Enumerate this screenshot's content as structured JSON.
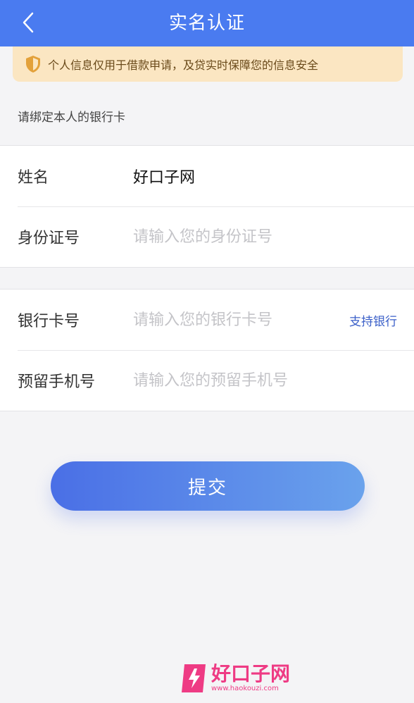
{
  "header": {
    "title": "实名认证",
    "back_icon": "chevron-left-icon",
    "background": "#4a7bf0"
  },
  "notice": {
    "icon": "shield-icon",
    "text": "个人信息仅用于借款申请，及贷实时保障您的信息安全",
    "background": "#fbe6c2"
  },
  "hint": "请绑定本人的银行卡",
  "form": {
    "name": {
      "label": "姓名",
      "value": "好口子网"
    },
    "id_number": {
      "label": "身份证号",
      "placeholder": "请输入您的身份证号"
    },
    "bank_card": {
      "label": "银行卡号",
      "placeholder": "请输入您的银行卡号",
      "support_link": "支持银行"
    },
    "phone": {
      "label": "预留手机号",
      "placeholder": "请输入您的预留手机号"
    }
  },
  "submit": {
    "label": "提交"
  },
  "watermark": {
    "name": "好口子网",
    "url": "www.haokouzi.com"
  }
}
